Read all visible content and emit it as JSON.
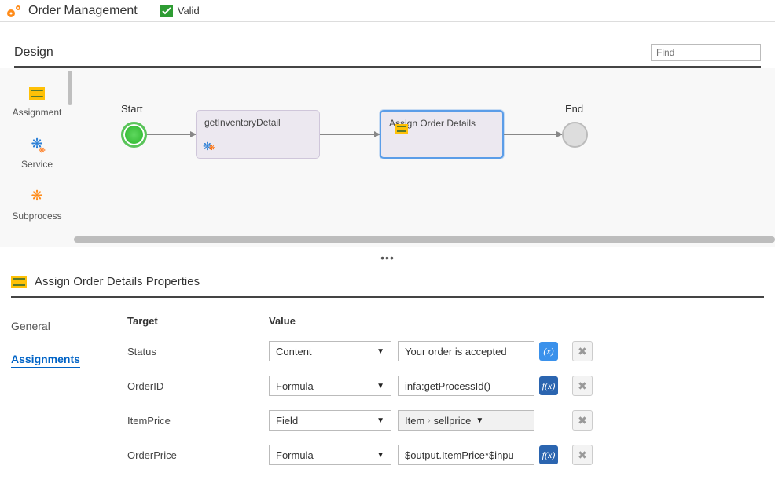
{
  "header": {
    "title": "Order Management",
    "status": "Valid"
  },
  "design": {
    "label": "Design",
    "find_placeholder": "Find",
    "palette": [
      {
        "label": "Assignment"
      },
      {
        "label": "Service"
      },
      {
        "label": "Subprocess"
      }
    ],
    "nodes": {
      "start": "Start",
      "step1": "getInventoryDetail",
      "step2": "Assign Order Details",
      "end": "End"
    }
  },
  "props": {
    "title": "Assign Order Details Properties",
    "tabs": [
      "General",
      "Assignments"
    ],
    "active_tab": "Assignments",
    "cols": {
      "target": "Target",
      "value": "Value"
    },
    "rows": [
      {
        "name": "Status",
        "type": "Content",
        "value": "Your order is accepted",
        "kind": "content"
      },
      {
        "name": "OrderID",
        "type": "Formula",
        "value": "infa:getProcessId()",
        "kind": "formula"
      },
      {
        "name": "ItemPrice",
        "type": "Field",
        "field_root": "Item",
        "field_leaf": "sellprice",
        "kind": "field"
      },
      {
        "name": "OrderPrice",
        "type": "Formula",
        "value": "$output.ItemPrice*$inpu",
        "kind": "formula"
      }
    ],
    "fx": {
      "x": "(x)",
      "f": "f(x)"
    }
  }
}
